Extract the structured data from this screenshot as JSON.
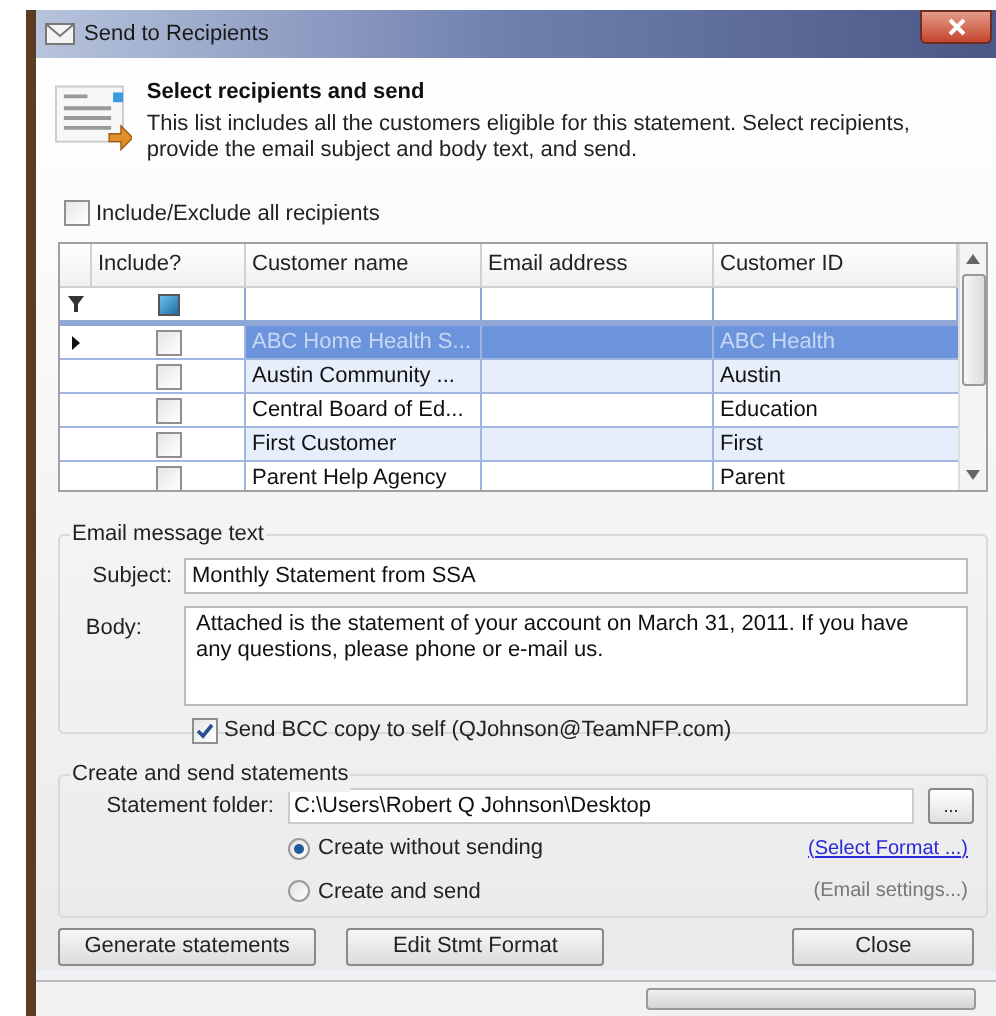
{
  "window": {
    "title": "Send to Recipients"
  },
  "header": {
    "title": "Select recipients and send",
    "description": "This list includes all the customers eligible for this statement.  Select recipients, provide the email subject and body text, and send."
  },
  "include_all": {
    "label": "Include/Exclude all recipients",
    "checked": false
  },
  "table": {
    "filter_include": {
      "checked": true
    },
    "columns": [
      "Include?",
      "Customer name",
      "Email address",
      "Customer ID"
    ],
    "rows": [
      {
        "selected": true,
        "included": false,
        "name": "ABC Home Health S...",
        "id": "ABC Health"
      },
      {
        "selected": false,
        "included": false,
        "name": "Austin Community ...",
        "id": "Austin"
      },
      {
        "selected": false,
        "included": false,
        "name": "Central Board of Ed...",
        "id": "Education"
      },
      {
        "selected": false,
        "included": false,
        "name": "First Customer",
        "id": "First"
      },
      {
        "selected": false,
        "included": false,
        "name": "Parent Help Agency",
        "id": "Parent"
      }
    ]
  },
  "email": {
    "title": "Email message text",
    "subject_label": "Subject:",
    "subject": "Monthly Statement from SSA",
    "body_label": "Body:",
    "body": "Attached is the statement of your account on March 31, 2011.  If you have any questions, please phone or e-mail us.",
    "bcc": {
      "label": "Send BCC copy to self (QJohnson@TeamNFP.com)",
      "checked": true
    }
  },
  "create": {
    "title": "Create and send statements",
    "folder_label": "Statement folder:",
    "folder": "C:\\Users\\Robert Q Johnson\\Desktop",
    "browse": "...",
    "options": [
      {
        "label": "Create without sending",
        "selected": true,
        "link": "(Select Format ...)",
        "link_disabled": false
      },
      {
        "label": "Create and send",
        "selected": false,
        "link": "(Email settings...)",
        "link_disabled": true
      }
    ]
  },
  "buttons": [
    "Generate statements",
    "Edit Stmt Format",
    "Close"
  ],
  "status_bar": {
    "progress": {
      "level": 0
    }
  }
}
